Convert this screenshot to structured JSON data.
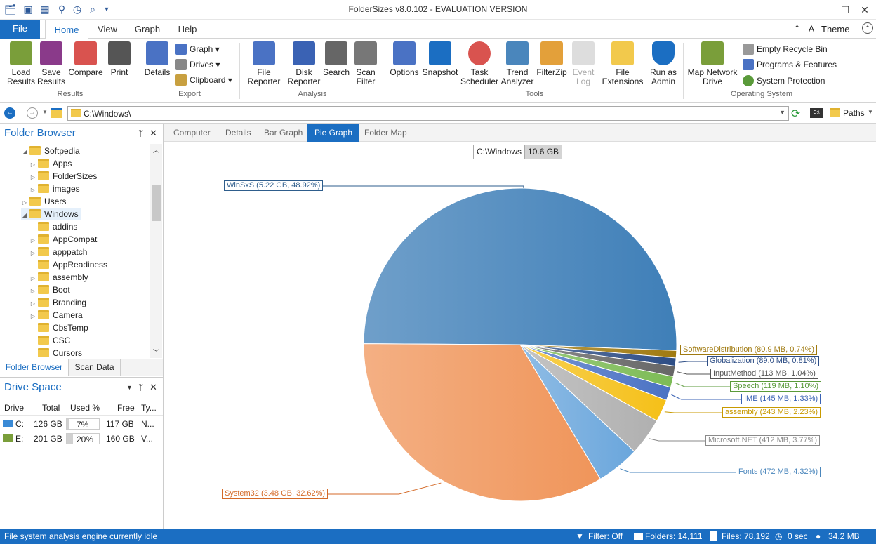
{
  "window": {
    "title": "FolderSizes v8.0.102 - EVALUATION VERSION",
    "minimize": "—",
    "maximize": "☐",
    "close": "✕"
  },
  "ribbon_tabs": {
    "file": "File",
    "home": "Home",
    "view": "View",
    "graph": "Graph",
    "help": "Help",
    "theme": "Theme"
  },
  "ribbon": {
    "load_results": "Load\nResults",
    "save_results": "Save\nResults",
    "compare": "Compare",
    "print": "Print",
    "group_results": "Results",
    "details": "Details",
    "graph": "Graph",
    "drives": "Drives",
    "clipboard": "Clipboard",
    "group_export": "Export",
    "file_reporter": "File\nReporter",
    "disk_reporter": "Disk\nReporter",
    "search": "Search",
    "scan_filter": "Scan\nFilter",
    "group_analysis": "Analysis",
    "options": "Options",
    "snapshot": "Snapshot",
    "task_scheduler": "Task\nScheduler",
    "trend_analyzer": "Trend\nAnalyzer",
    "filezip": "FilterZip",
    "event_log": "Event\nLog",
    "file_extensions": "File\nExtensions",
    "run_as_admin": "Run as\nAdmin",
    "group_tools": "Tools",
    "map_network_drive": "Map Network\nDrive",
    "empty_recycle_bin": "Empty Recycle Bin",
    "programs_features": "Programs & Features",
    "system_protection": "System Protection",
    "group_os": "Operating System"
  },
  "address": {
    "path": "C:\\Windows\\",
    "paths_button": "Paths"
  },
  "folder_browser": {
    "title": "Folder Browser",
    "items": [
      {
        "label": "Softpedia",
        "indent": 0,
        "expand": "◢"
      },
      {
        "label": "Apps",
        "indent": 1,
        "expand": "▷"
      },
      {
        "label": "FolderSizes",
        "indent": 1,
        "expand": "▷"
      },
      {
        "label": "images",
        "indent": 1,
        "expand": "▷"
      },
      {
        "label": "Users",
        "indent": 0,
        "expand": "▷"
      },
      {
        "label": "Windows",
        "indent": 0,
        "expand": "◢"
      },
      {
        "label": "addins",
        "indent": 1,
        "expand": ""
      },
      {
        "label": "AppCompat",
        "indent": 1,
        "expand": "▷"
      },
      {
        "label": "apppatch",
        "indent": 1,
        "expand": "▷"
      },
      {
        "label": "AppReadiness",
        "indent": 1,
        "expand": ""
      },
      {
        "label": "assembly",
        "indent": 1,
        "expand": "▷"
      },
      {
        "label": "Boot",
        "indent": 1,
        "expand": "▷"
      },
      {
        "label": "Branding",
        "indent": 1,
        "expand": "▷"
      },
      {
        "label": "Camera",
        "indent": 1,
        "expand": "▷"
      },
      {
        "label": "CbsTemp",
        "indent": 1,
        "expand": ""
      },
      {
        "label": "CSC",
        "indent": 1,
        "expand": ""
      },
      {
        "label": "Cursors",
        "indent": 1,
        "expand": ""
      }
    ],
    "tab_folder_browser": "Folder Browser",
    "tab_scan_data": "Scan Data"
  },
  "drive_space": {
    "title": "Drive Space",
    "columns": [
      "Drive",
      "Total",
      "Used %",
      "Free",
      "Ty..."
    ],
    "rows": [
      {
        "drive": "C:",
        "total": "126 GB",
        "used": "7%",
        "used_frac": 0.07,
        "free": "117 GB",
        "type": "N..."
      },
      {
        "drive": "E:",
        "total": "201 GB",
        "used": "20%",
        "used_frac": 0.2,
        "free": "160 GB",
        "type": "V..."
      }
    ]
  },
  "view_tabs": {
    "computer": "Computer",
    "details": "Details",
    "bar_graph": "Bar Graph",
    "pie_graph": "Pie Graph",
    "folder_map": "Folder Map"
  },
  "breadcrumb": {
    "path": "C:\\Windows",
    "size": "10.6 GB"
  },
  "chart_data": {
    "type": "pie",
    "slices": [
      {
        "label": "WinSxS (5.22 GB, 48.92%)",
        "value": 48.92,
        "color": "#3f7fb8",
        "labelcolor": "#2e5d8c"
      },
      {
        "label": "SoftwareDistribution (80.9 MB, 0.74%)",
        "value": 0.74,
        "color": "#a07a10",
        "labelcolor": "#a07a10"
      },
      {
        "label": "Globalization (89.0 MB, 0.81%)",
        "value": 0.81,
        "color": "#2d4d85",
        "labelcolor": "#2d4d85"
      },
      {
        "label": "InputMethod (113 MB, 1.04%)",
        "value": 1.04,
        "color": "#666666",
        "labelcolor": "#555555"
      },
      {
        "label": "Speech (119 MB, 1.10%)",
        "value": 1.1,
        "color": "#7cbb55",
        "labelcolor": "#5a9a3a"
      },
      {
        "label": "IME (145 MB, 1.33%)",
        "value": 1.33,
        "color": "#4a72c4",
        "labelcolor": "#3a62b4"
      },
      {
        "label": "assembly (243 MB, 2.23%)",
        "value": 2.23,
        "color": "#f5c018",
        "labelcolor": "#c89a00"
      },
      {
        "label": "Microsoft.NET (412 MB, 3.77%)",
        "value": 3.77,
        "color": "#b0b0b0",
        "labelcolor": "#8a8a8a"
      },
      {
        "label": "Fonts (472 MB, 4.32%)",
        "value": 4.32,
        "color": "#6aa6dc",
        "labelcolor": "#4a86bc"
      },
      {
        "label": "System32 (3.48 GB, 32.62%)",
        "value": 32.62,
        "color": "#f0955a",
        "labelcolor": "#d46a28"
      }
    ]
  },
  "status": {
    "idle": "File system analysis engine currently idle",
    "filter": "Filter: Off",
    "folders": "Folders: 14,111",
    "files": "Files: 78,192",
    "time": "0 sec",
    "size": "34.2 MB"
  }
}
